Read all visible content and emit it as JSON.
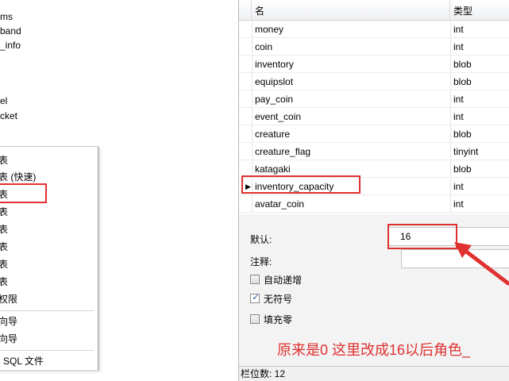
{
  "tree_items": [
    "ms",
    "band",
    "_info",
    "el",
    "cket"
  ],
  "menu_items": [
    "表",
    "表 (快速)",
    "表",
    "表",
    "表",
    "表",
    "表",
    "表",
    "权限",
    "向导",
    "向导",
    "i SQL 文件"
  ],
  "grid": {
    "col_name": "名",
    "col_type": "类型",
    "rows": [
      {
        "name": "money",
        "type": "int"
      },
      {
        "name": "coin",
        "type": "int"
      },
      {
        "name": "inventory",
        "type": "blob"
      },
      {
        "name": "equipslot",
        "type": "blob"
      },
      {
        "name": "pay_coin",
        "type": "int"
      },
      {
        "name": "event_coin",
        "type": "int"
      },
      {
        "name": "creature",
        "type": "blob"
      },
      {
        "name": "creature_flag",
        "type": "tinyint"
      },
      {
        "name": "katagaki",
        "type": "blob"
      },
      {
        "name": "inventory_capacity",
        "type": "int"
      },
      {
        "name": "avatar_coin",
        "type": "int"
      }
    ]
  },
  "props": {
    "default_label": "默认:",
    "default_value": "16",
    "comment_label": "注释:",
    "auto_increment_label": "自动递增",
    "unsigned_label": "无符号",
    "zerofill_label": "填充零",
    "auto_increment": false,
    "unsigned": true,
    "zerofill": false
  },
  "annotation": "原来是0   这里改成16以后角色_",
  "status": "栏位数: 12",
  "colors": {
    "highlight": "#e03030",
    "check": "#1f4fa3"
  },
  "icons": {
    "row_pointer": "black-triangle-right-icon",
    "arrow": "red-arrow-icon"
  }
}
